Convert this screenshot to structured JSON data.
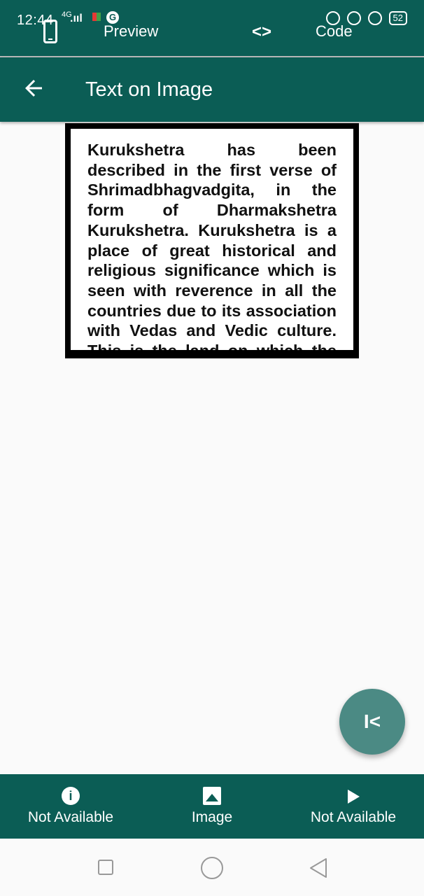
{
  "status_bar": {
    "time": "12:44",
    "network": "4G",
    "battery": "52"
  },
  "top_tabs": {
    "preview_label": "Preview",
    "code_label": "Code",
    "toggle_glyph": "<>"
  },
  "app_bar": {
    "title": "Text on Image"
  },
  "card": {
    "text": "Kurukshetra has been described in the first verse of Shrimadbhagvadgita, in the form of Dharmakshetra Kurukshetra. Kurukshetra is a place of great historical and religious significance which is seen with reverence in all the countries due to its association with Vedas and Vedic culture. This is the land on which the battle of Mahabharata"
  },
  "fab": {
    "glyph": "I<"
  },
  "bottom_nav": {
    "items": [
      {
        "label": "Not Available",
        "icon": "info-icon"
      },
      {
        "label": "Image",
        "icon": "image-icon"
      },
      {
        "label": "Not Available",
        "icon": "play-icon"
      }
    ]
  },
  "colors": {
    "primary": "#0b5d55",
    "fab": "#4b8a84",
    "background": "#fafafa"
  }
}
